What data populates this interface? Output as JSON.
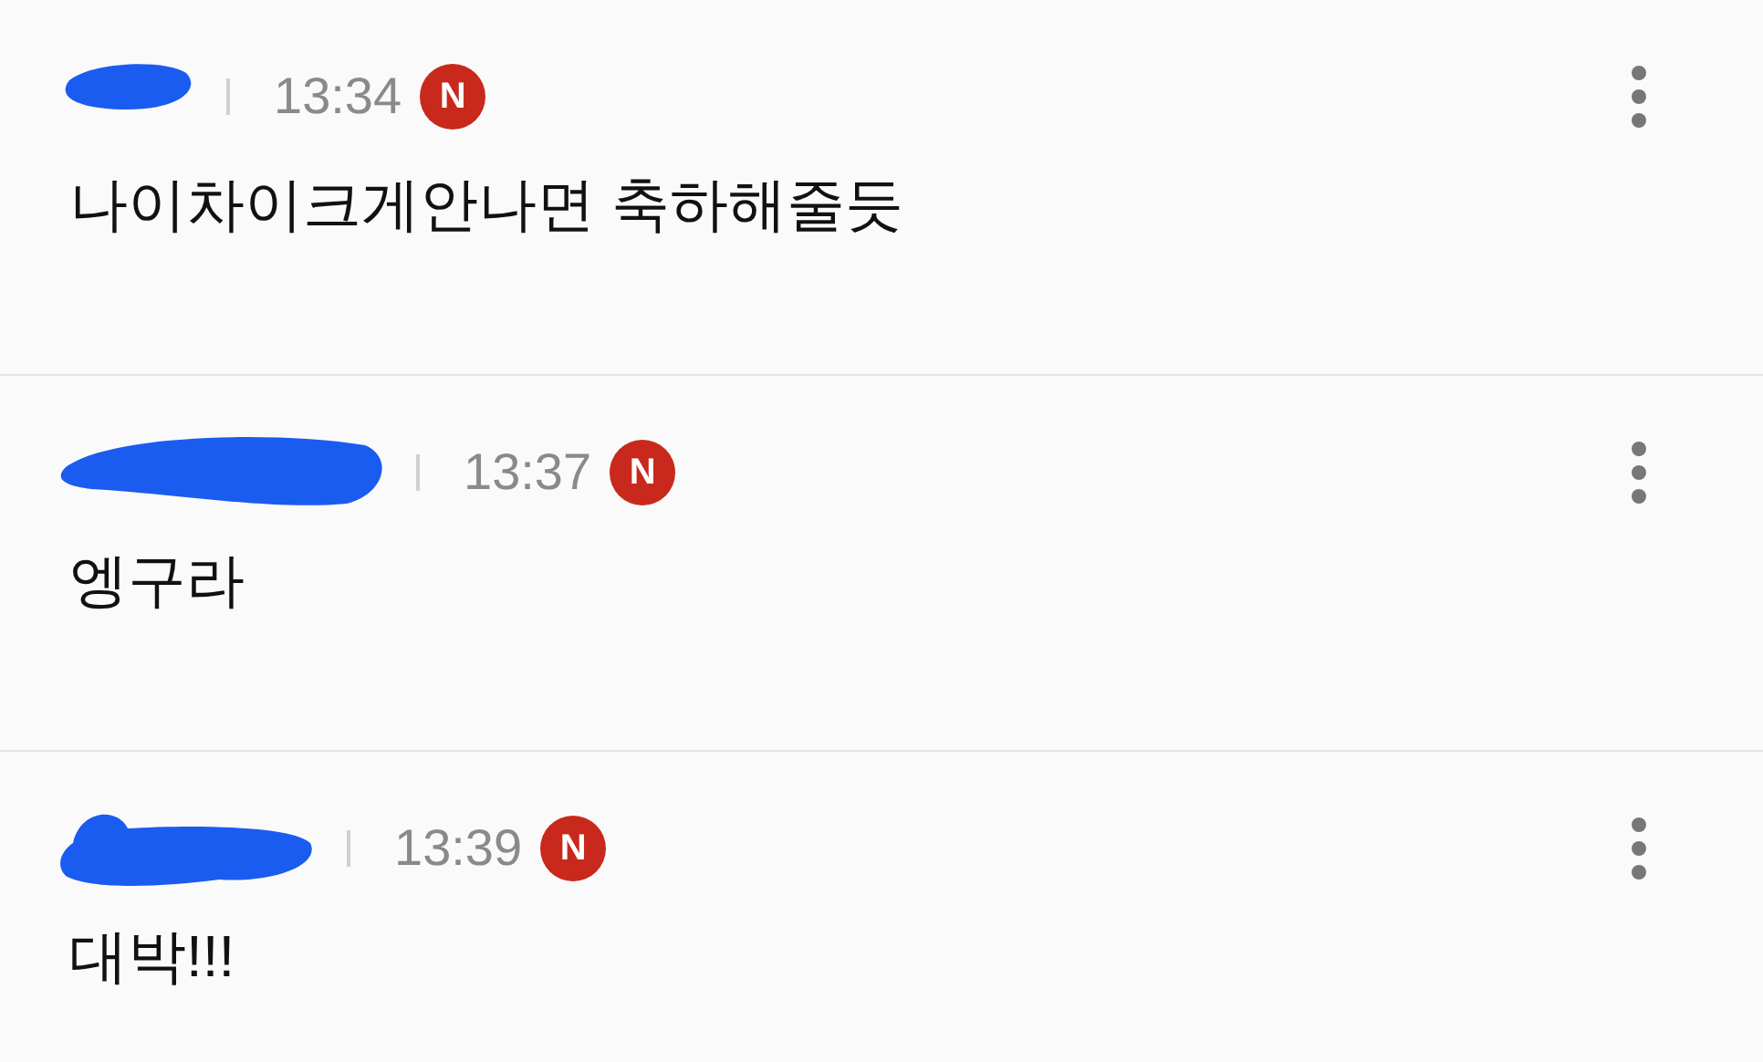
{
  "comments": [
    {
      "author_redacted": true,
      "time": "13:34",
      "badge": "N",
      "text": "나이차이크게안나면 축하해줄듯"
    },
    {
      "author_redacted": true,
      "time": "13:37",
      "badge": "N",
      "text": "엥구라"
    },
    {
      "author_redacted": true,
      "time": "13:39",
      "badge": "N",
      "text": "대박!!!"
    }
  ]
}
